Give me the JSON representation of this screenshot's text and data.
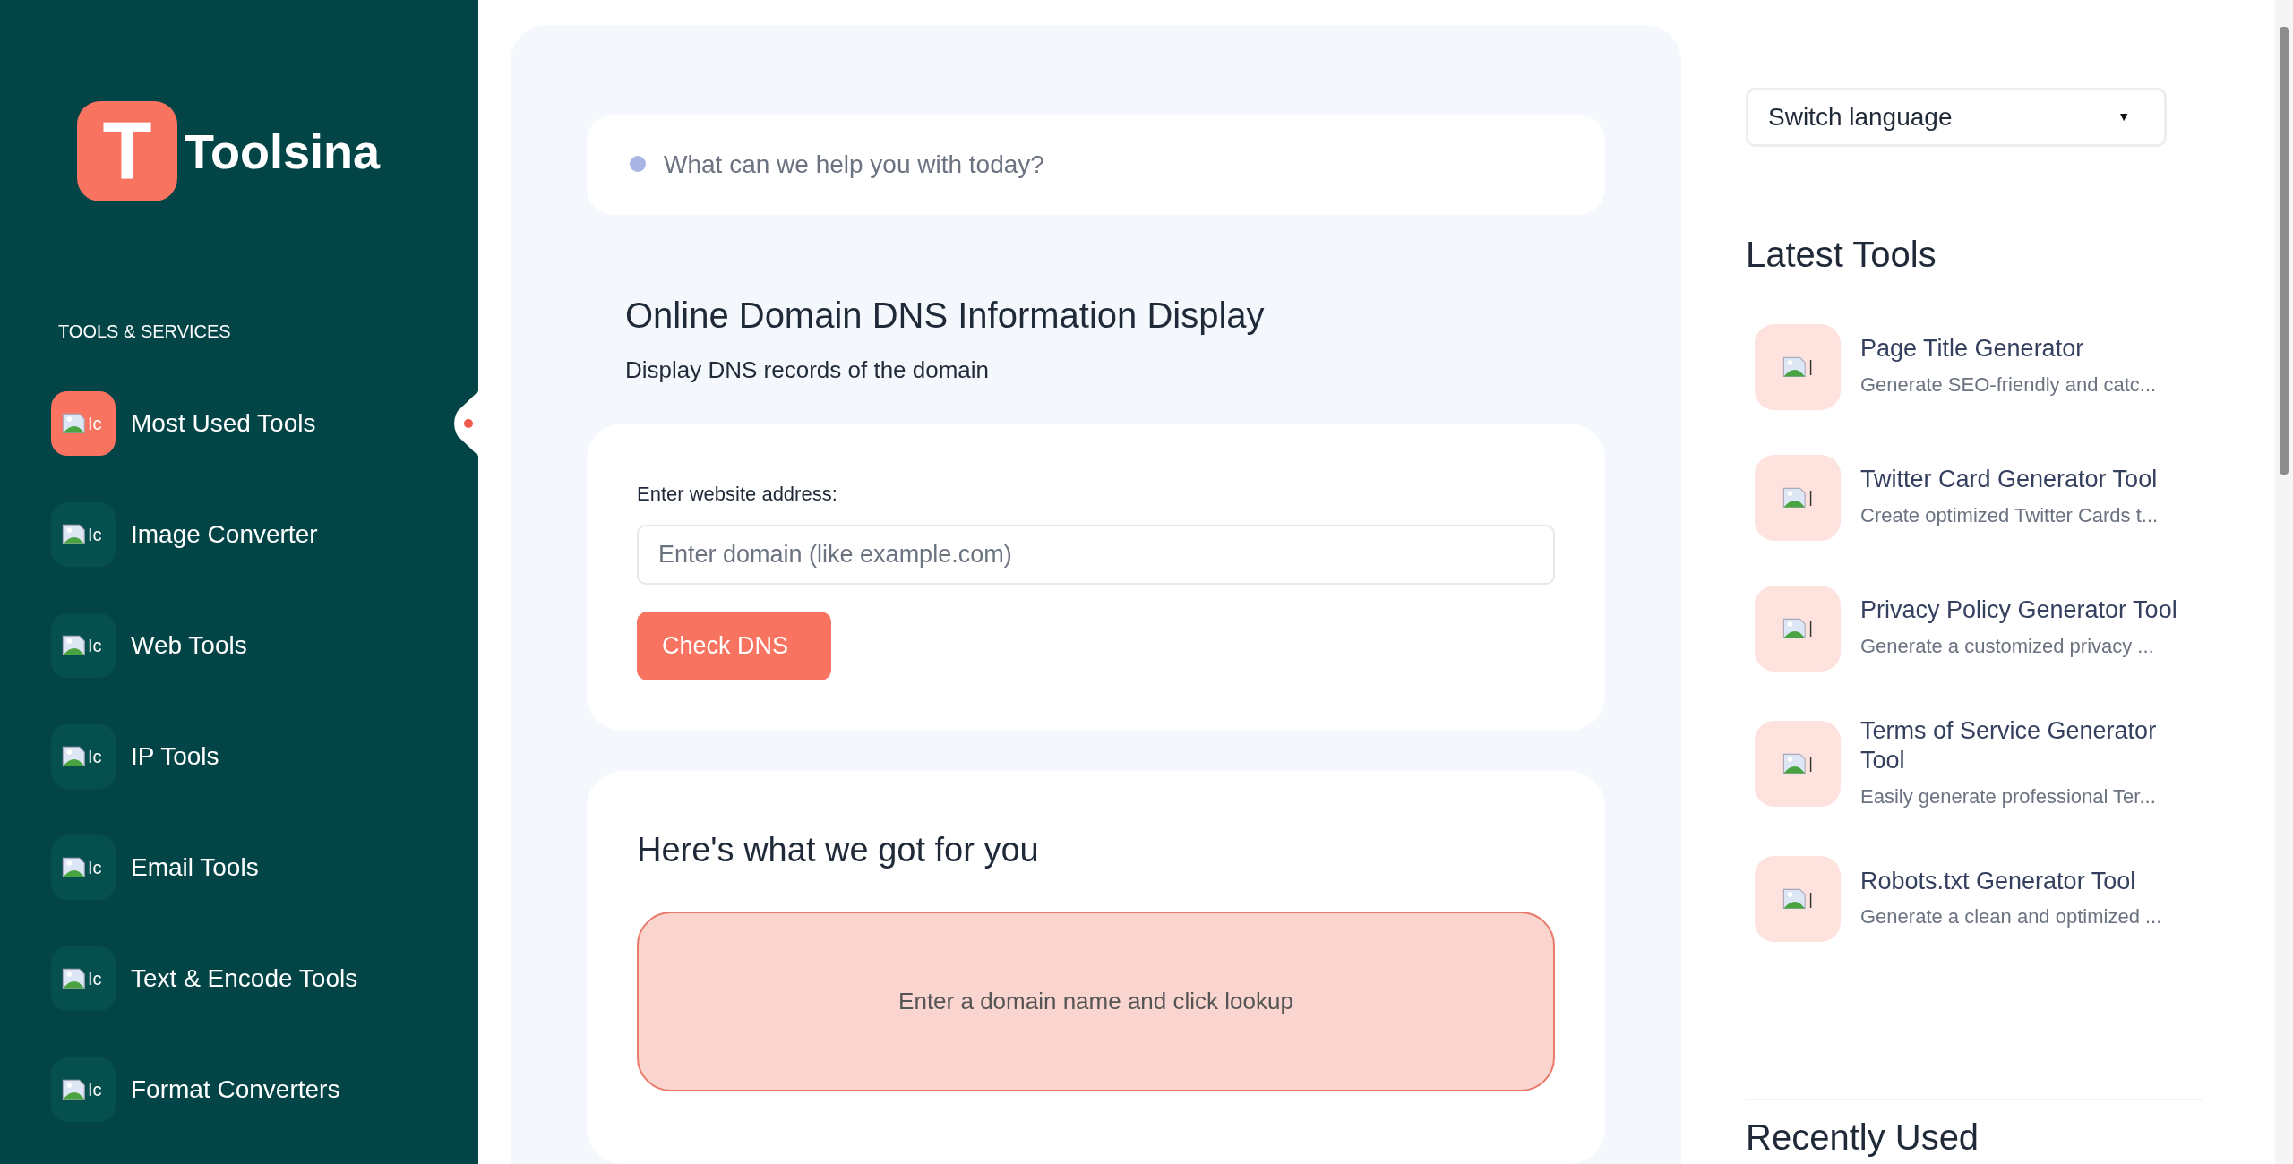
{
  "brand": {
    "logo_letter": "T",
    "name": "Toolsina"
  },
  "sidebar": {
    "heading": "TOOLS & SERVICES",
    "items": [
      {
        "label": "Most Used Tools",
        "icon_alt": "Ic",
        "selected": true
      },
      {
        "label": "Image Converter",
        "icon_alt": "Ic",
        "selected": false
      },
      {
        "label": "Web Tools",
        "icon_alt": "Ic",
        "selected": false
      },
      {
        "label": "IP Tools",
        "icon_alt": "Ic",
        "selected": false
      },
      {
        "label": "Email Tools",
        "icon_alt": "Ic",
        "selected": false
      },
      {
        "label": "Text & Encode Tools",
        "icon_alt": "Ic",
        "selected": false
      },
      {
        "label": "Format Converters",
        "icon_alt": "Ic",
        "selected": false
      }
    ]
  },
  "search": {
    "placeholder": "What can we help you with today?"
  },
  "tool": {
    "title": "Online Domain DNS Information Display",
    "subtitle": "Display DNS records of the domain",
    "field_label": "Enter website address:",
    "field_placeholder": "Enter domain (like example.com)",
    "button": "Check DNS"
  },
  "results": {
    "heading": "Here's what we got for you",
    "message": "Enter a domain name and click lookup"
  },
  "language_select": {
    "value": "Switch language",
    "caret": "▼"
  },
  "latest_tools": {
    "heading": "Latest Tools",
    "items": [
      {
        "title": "Page Title Generator",
        "description": "Generate SEO-friendly and catc...",
        "icon_alt": "|"
      },
      {
        "title": "Twitter Card Generator Tool",
        "description": "Create optimized Twitter Cards t...",
        "icon_alt": "|"
      },
      {
        "title": "Privacy Policy Generator Tool",
        "description": "Generate a customized privacy ...",
        "icon_alt": "|"
      },
      {
        "title": "Terms of Service Generator Tool",
        "description": "Easily generate professional Ter...",
        "icon_alt": "|"
      },
      {
        "title": "Robots.txt Generator Tool",
        "description": "Generate a clean and optimized ...",
        "icon_alt": "|"
      }
    ]
  },
  "recently_used": {
    "heading": "Recently Used"
  }
}
